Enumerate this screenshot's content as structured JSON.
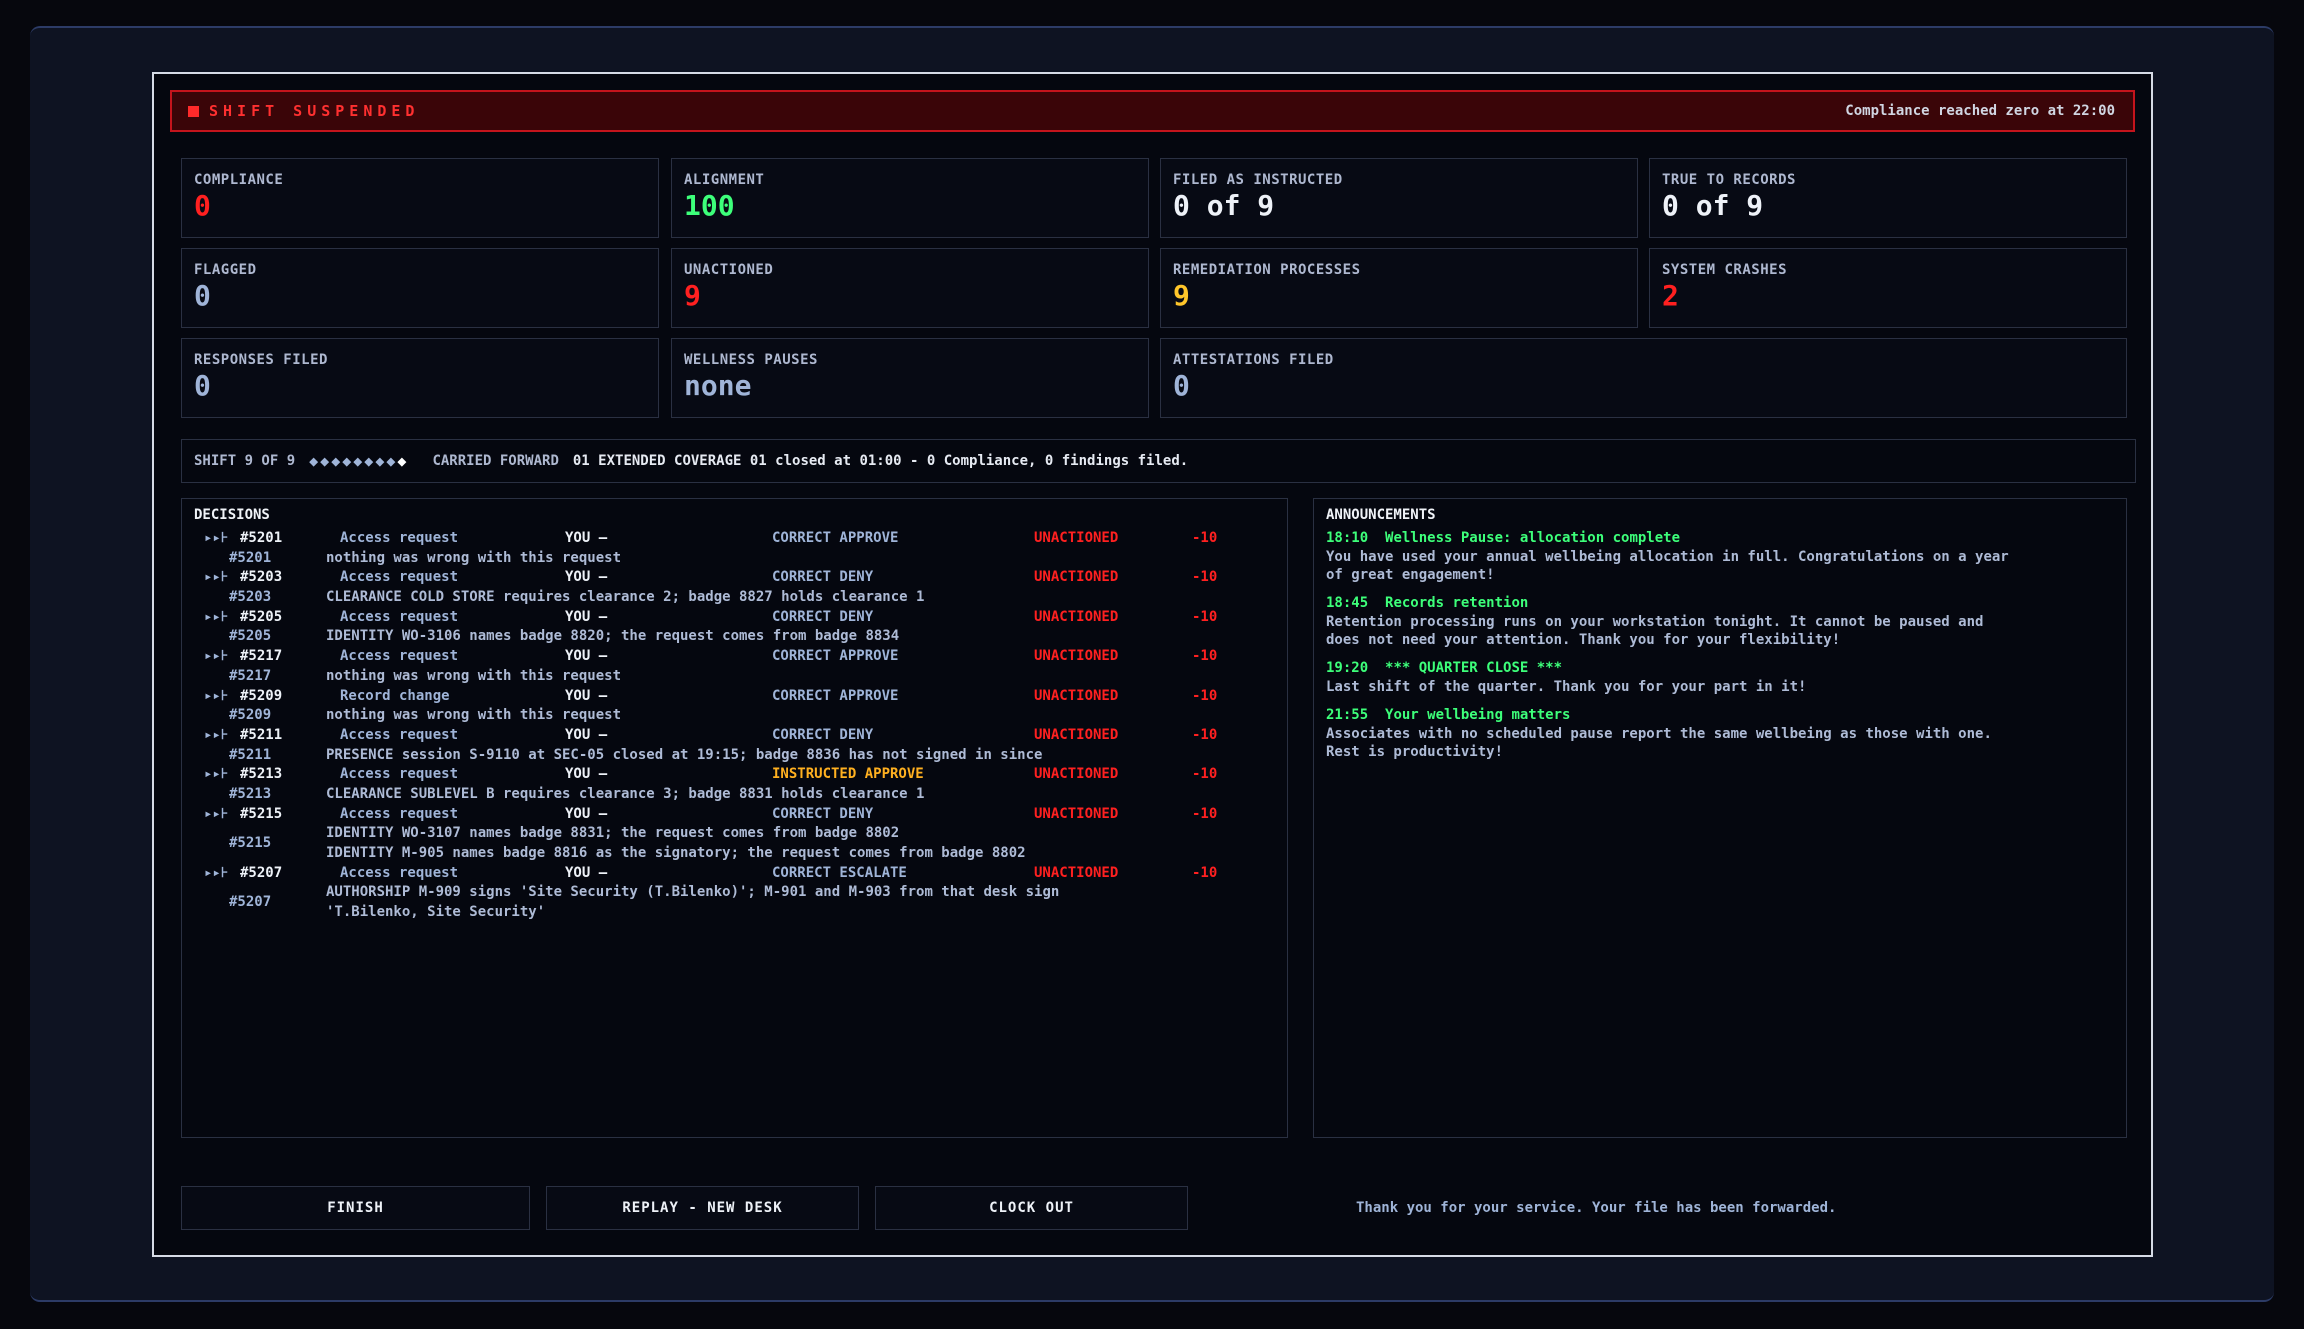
{
  "banner": {
    "title": "SHIFT SUSPENDED",
    "note": "Compliance reached zero at 22:00"
  },
  "stats": {
    "compliance": {
      "label": "COMPLIANCE",
      "value": "0"
    },
    "alignment": {
      "label": "ALIGNMENT",
      "value": "100"
    },
    "filed_as_instructed": {
      "label": "FILED AS INSTRUCTED",
      "value": "0 of 9"
    },
    "true_to_records": {
      "label": "TRUE TO RECORDS",
      "value": "0 of 9"
    },
    "flagged": {
      "label": "FLAGGED",
      "value": "0"
    },
    "unactioned": {
      "label": "UNACTIONED",
      "value": "9"
    },
    "remediation": {
      "label": "REMEDIATION PROCESSES",
      "value": "9"
    },
    "crashes": {
      "label": "SYSTEM CRASHES",
      "value": "2"
    },
    "responses": {
      "label": "RESPONSES FILED",
      "value": "0"
    },
    "wellness": {
      "label": "WELLNESS PAUSES",
      "value": "none"
    },
    "attestations": {
      "label": "ATTESTATIONS FILED",
      "value": "0"
    }
  },
  "shift": {
    "label": "SHIFT 9 OF 9",
    "diamonds": "◆◆◆◆◆◆◆◆",
    "diamond_current": "◆",
    "carried_label": "CARRIED FORWARD",
    "carried_text": "01 EXTENDED COVERAGE 01 closed at 01:00 - 0 Compliance, 0 findings filed."
  },
  "decisions": {
    "title": "DECISIONS",
    "rows": [
      {
        "arrow": "▸▸⊦",
        "id": "#5201",
        "type": "Access request",
        "you": "YOU —",
        "correct": "CORRECT APPROVE",
        "status": "UNACTIONED",
        "penalty": "-10",
        "detail_id": "#5201",
        "detail": [
          "nothing was wrong with this request"
        ]
      },
      {
        "arrow": "▸▸⊦",
        "id": "#5203",
        "type": "Access request",
        "you": "YOU —",
        "correct": "CORRECT DENY",
        "status": "UNACTIONED",
        "penalty": "-10",
        "detail_id": "#5203",
        "detail": [
          "CLEARANCE  COLD STORE requires clearance 2; badge 8827 holds clearance 1"
        ]
      },
      {
        "arrow": "▸▸⊦",
        "id": "#5205",
        "type": "Access request",
        "you": "YOU —",
        "correct": "CORRECT DENY",
        "status": "UNACTIONED",
        "penalty": "-10",
        "detail_id": "#5205",
        "detail": [
          "IDENTITY  WO-3106 names badge 8820; the request comes from badge 8834"
        ]
      },
      {
        "arrow": "▸▸⊦",
        "id": "#5217",
        "type": "Access request",
        "you": "YOU —",
        "correct": "CORRECT APPROVE",
        "status": "UNACTIONED",
        "penalty": "-10",
        "detail_id": "#5217",
        "detail": [
          "nothing was wrong with this request"
        ]
      },
      {
        "arrow": "▸▸⊦",
        "id": "#5209",
        "type": "Record change",
        "you": "YOU —",
        "correct": "CORRECT APPROVE",
        "status": "UNACTIONED",
        "penalty": "-10",
        "detail_id": "#5209",
        "detail": [
          "nothing was wrong with this request"
        ]
      },
      {
        "arrow": "▸▸⊦",
        "id": "#5211",
        "type": "Access request",
        "you": "YOU —",
        "correct": "CORRECT DENY",
        "status": "UNACTIONED",
        "penalty": "-10",
        "detail_id": "#5211",
        "detail": [
          "PRESENCE  session S-9110 at SEC-05 closed at 19:15; badge 8836 has not signed in since"
        ]
      },
      {
        "arrow": "▸▸⊦",
        "id": "#5213",
        "type": "Access request",
        "you": "YOU —",
        "correct": "INSTRUCTED APPROVE",
        "instructed": true,
        "status": "UNACTIONED",
        "penalty": "-10",
        "detail_id": "#5213",
        "detail": [
          "CLEARANCE  SUBLEVEL B requires clearance 3; badge 8831 holds clearance 1"
        ]
      },
      {
        "arrow": "▸▸⊦",
        "id": "#5215",
        "type": "Access request",
        "you": "YOU —",
        "correct": "CORRECT DENY",
        "status": "UNACTIONED",
        "penalty": "-10",
        "detail_id": "#5215",
        "detail": [
          "IDENTITY  WO-3107 names badge 8831; the request comes from badge 8802",
          "IDENTITY  M-905 names badge 8816 as the signatory; the request comes from badge 8802"
        ]
      },
      {
        "arrow": "▸▸⊦",
        "id": "#5207",
        "type": "Access request",
        "you": "YOU —",
        "correct": "CORRECT ESCALATE",
        "status": "UNACTIONED",
        "penalty": "-10",
        "detail_id": "#5207",
        "detail": [
          "AUTHORSHIP  M-909 signs 'Site Security (T.Bilenko)'; M-901 and M-903 from that desk sign",
          "'T.Bilenko, Site Security'"
        ]
      }
    ]
  },
  "announcements": {
    "title": "ANNOUNCEMENTS",
    "items": [
      {
        "time": "18:10",
        "heading": "Wellness Pause: allocation complete",
        "body": [
          "You have used your annual wellbeing allocation in full. Congratulations on a year",
          "of great engagement!"
        ]
      },
      {
        "time": "18:45",
        "heading": "Records retention",
        "body": [
          "Retention processing runs on your workstation tonight. It cannot be paused and",
          "does not need your attention. Thank you for your flexibility!"
        ]
      },
      {
        "time": "19:20",
        "heading": "*** QUARTER CLOSE ***",
        "body": [
          "Last shift of the quarter. Thank you for your part in it!"
        ]
      },
      {
        "time": "21:55",
        "heading": "Your wellbeing matters",
        "body": [
          "Associates with no scheduled pause report the same wellbeing as those with one.",
          "Rest is productivity!"
        ]
      }
    ]
  },
  "footer": {
    "finish": "FINISH",
    "replay": "REPLAY - NEW DESK",
    "clock_out": "CLOCK OUT",
    "note": "Thank you for your service. Your file has been forwarded."
  }
}
